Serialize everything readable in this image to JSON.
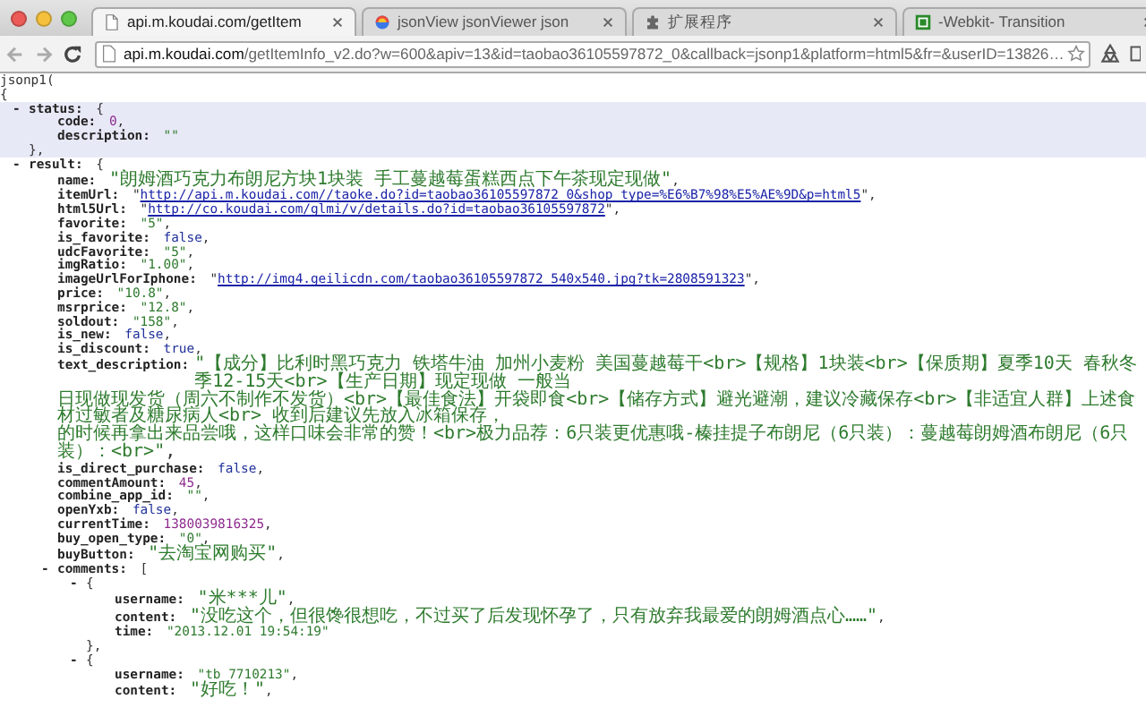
{
  "browser": {
    "tabs": [
      {
        "title": "api.m.koudai.com/getItem",
        "selected": true
      },
      {
        "title": "jsonView jsonViewer json",
        "selected": false
      },
      {
        "title": "扩展程序",
        "selected": false
      },
      {
        "title": "-Webkit- Transition",
        "selected": false
      }
    ],
    "url": {
      "host": "api.m.koudai.com",
      "path": "/getItemInfo_v2.do?w=600&apiv=13&id=taobao36105597872_0&callback=jsonp1&platform=html5&fr=&userID=13826…"
    }
  },
  "viewer": {
    "prefix": "jsonp1(",
    "root": {
      "kind": "object",
      "open": "{",
      "expanded": true,
      "children": [
        {
          "kind": "object",
          "toggle": "-",
          "key": "status:",
          "open": "{",
          "expanded": true,
          "highlighted": true,
          "close": "},",
          "children": [
            {
              "kind": "number",
              "key": "code:",
              "value": "0",
              "tail": ","
            },
            {
              "kind": "string",
              "key": "description:",
              "value": "\"\""
            }
          ]
        },
        {
          "kind": "object",
          "toggle": "-",
          "key": "result:",
          "open": "{",
          "expanded": true,
          "highlighted": false,
          "children": [
            {
              "kind": "string",
              "key": "name:",
              "value": "\"朗姆酒巧克力布朗尼方块1块装 手工蔓越莓蛋糕西点下午茶现定现做\"",
              "tail": ","
            },
            {
              "kind": "link",
              "key": "itemUrl:",
              "lead": "\"",
              "value": "http://api.m.koudai.com//taoke.do?id=taobao36105597872_0&shop_type=%E6%B7%98%E5%AE%9D&p=html5",
              "tail": "\","
            },
            {
              "kind": "link",
              "key": "html5Url:",
              "lead": "\"",
              "value": "http://co.koudai.com/glmi/v/details.do?id=taobao36105597872",
              "tail": "\","
            },
            {
              "kind": "string",
              "key": "favorite:",
              "value": "\"5\"",
              "tail": ","
            },
            {
              "kind": "boolean",
              "key": "is_favorite:",
              "value": "false",
              "tail": ","
            },
            {
              "kind": "string",
              "key": "udcFavorite:",
              "value": "\"5\"",
              "tail": ","
            },
            {
              "kind": "string",
              "key": "imgRatio:",
              "value": "\"1.00\"",
              "tail": ","
            },
            {
              "kind": "link",
              "key": "imageUrlForIphone:",
              "lead": "\"",
              "value": "http://img4.geilicdn.com/taobao36105597872_540x540.jpg?tk=2808591323",
              "tail": "\","
            },
            {
              "kind": "string",
              "key": "price:",
              "value": "\"10.8\"",
              "tail": ","
            },
            {
              "kind": "string",
              "key": "msrprice:",
              "value": "\"12.8\"",
              "tail": ","
            },
            {
              "kind": "string",
              "key": "soldout:",
              "value": "\"158\"",
              "tail": ","
            },
            {
              "kind": "boolean",
              "key": "is_new:",
              "value": "false",
              "tail": ","
            },
            {
              "kind": "boolean",
              "key": "is_discount:",
              "value": "true",
              "tail": ","
            },
            {
              "kind": "multiline",
              "key": "text_description:",
              "value_lines": [
                "\"【成分】比利时黑巧克力 铁塔牛油 加州小麦粉 美国蔓越莓干<br>【规格】1块装<br>【保质期】夏季10天 春秋冬季12-15天<br>【生产日期】现定现做 一般当",
                "日现做现发货（周六不制作不发货）<br>【最佳食法】开袋即食<br>【储存方式】避光避潮，建议冷藏保存<br>【非适宜人群】上述食材过敏者及糖尿病人<br> 收到后建议先放入冰箱保存，",
                "的时候再拿出来品尝哦，这样口味会非常的赞！<br>极力品荐：6只装更优惠哦-榛挂提子布朗尼（6只装）：蔓越莓朗姆酒布朗尼（6只装）：<br>\""
              ],
              "tail": ","
            },
            {
              "kind": "boolean",
              "key": "is_direct_purchase:",
              "value": "false",
              "tail": ","
            },
            {
              "kind": "number",
              "key": "commentAmount:",
              "value": "45",
              "tail": ","
            },
            {
              "kind": "string",
              "key": "combine_app_id:",
              "value": "\"\"",
              "tail": ","
            },
            {
              "kind": "boolean",
              "key": "openYxb:",
              "value": "false",
              "tail": ","
            },
            {
              "kind": "number",
              "key": "currentTime:",
              "value": "1380039816325",
              "tail": ","
            },
            {
              "kind": "string",
              "key": "buy_open_type:",
              "value": "\"0\"",
              "tail": ","
            },
            {
              "kind": "string",
              "key": "buyButton:",
              "value": "\"去淘宝网购买\"",
              "tail": ","
            },
            {
              "kind": "object",
              "toggle": "-",
              "key": "comments:",
              "open": "[",
              "expanded": true,
              "highlighted": false,
              "children": [
                {
                  "kind": "object",
                  "toggle": "-",
                  "open": "{",
                  "expanded": true,
                  "highlighted": false,
                  "close": "},",
                  "children": [
                    {
                      "kind": "string",
                      "key": "username:",
                      "value": "\"米***儿\"",
                      "tail": ","
                    },
                    {
                      "kind": "string",
                      "key": "content:",
                      "value": "\"没吃这个，但很馋很想吃，不过买了后发现怀孕了，只有放弃我最爱的朗姆酒点心……\"",
                      "tail": ","
                    },
                    {
                      "kind": "string",
                      "key": "time:",
                      "value": "\"2013.12.01 19:54:19\""
                    }
                  ]
                },
                {
                  "kind": "object",
                  "toggle": "-",
                  "open": "{",
                  "expanded": true,
                  "highlighted": false,
                  "children": [
                    {
                      "kind": "string",
                      "key": "username:",
                      "value": "\"tb_7710213\"",
                      "tail": ","
                    },
                    {
                      "kind": "string",
                      "key": "content:",
                      "value": "\"好吃！\"",
                      "tail": ","
                    }
                  ]
                }
              ]
            }
          ]
        }
      ]
    }
  }
}
